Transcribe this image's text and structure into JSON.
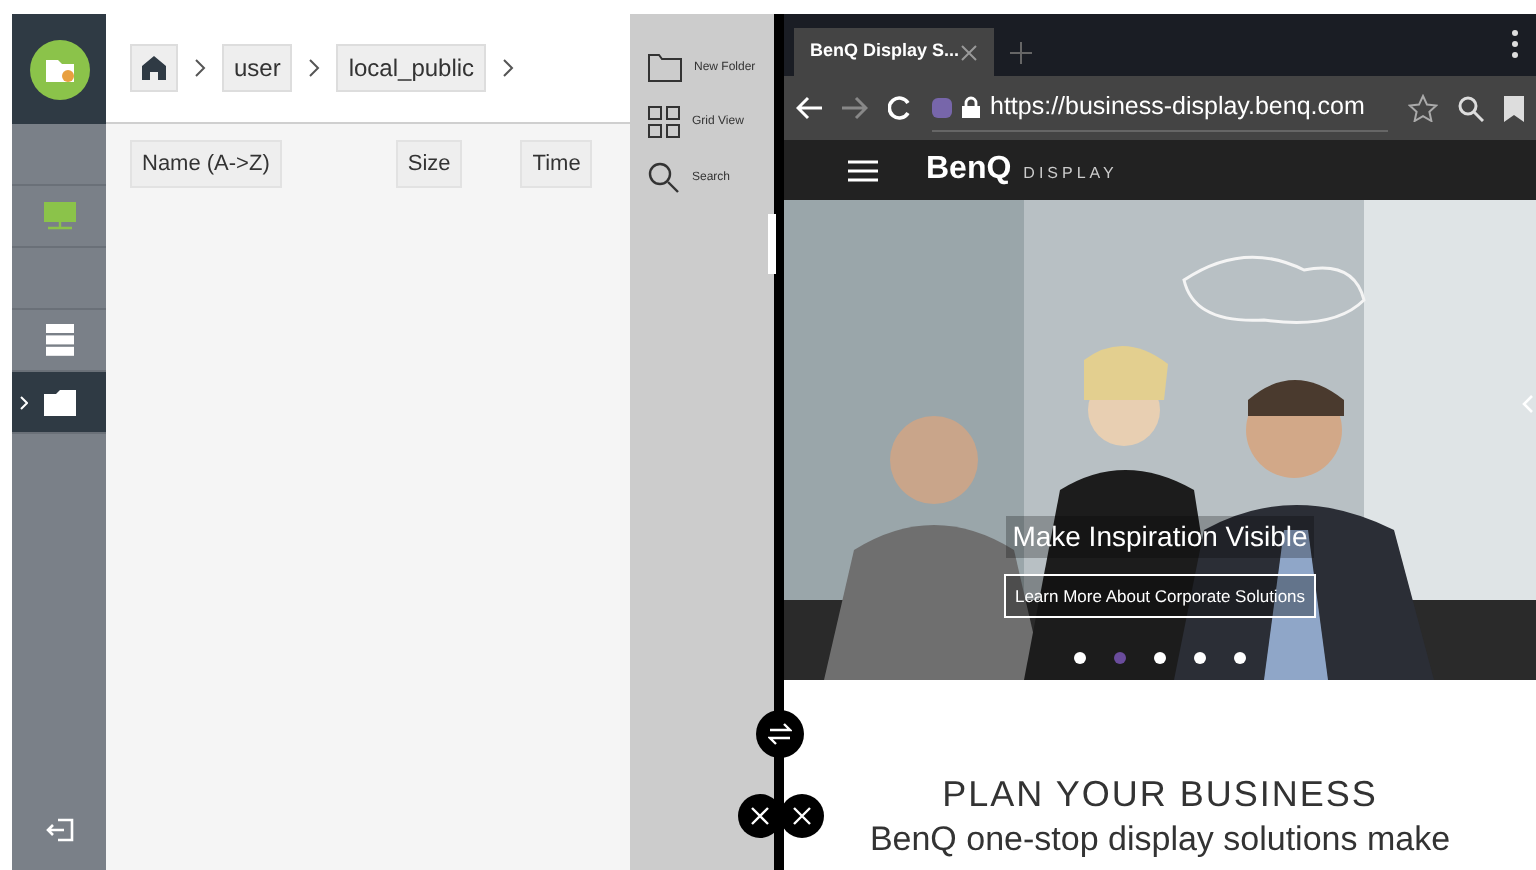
{
  "file_manager": {
    "breadcrumbs": [
      {
        "kind": "home"
      },
      {
        "kind": "crumb",
        "label": "user"
      },
      {
        "kind": "crumb",
        "label": "local_public"
      }
    ],
    "sidebar": [
      {
        "kind": "blank",
        "selected": false
      },
      {
        "kind": "network",
        "selected": false
      },
      {
        "kind": "blank",
        "selected": false
      },
      {
        "kind": "server",
        "selected": false
      },
      {
        "kind": "folder",
        "selected": true
      }
    ],
    "sort_buttons": [
      "Name (A->Z)",
      "Size",
      "Time"
    ],
    "tools": [
      {
        "kind": "new_folder",
        "label": "New Folder"
      },
      {
        "kind": "grid",
        "label": "Grid View"
      },
      {
        "kind": "search",
        "label": "Search"
      }
    ]
  },
  "browser": {
    "tab_title": "BenQ Display S...",
    "url": "https://business-display.benq.com",
    "site_logo": "BenQ",
    "site_logo_sub": "DISPLAY",
    "hero": {
      "headline": "Make Inspiration Visible",
      "button": "Learn More About Corporate Solutions",
      "dots": [
        {
          "selected": false
        },
        {
          "selected": true
        },
        {
          "selected": false
        },
        {
          "selected": false
        },
        {
          "selected": false
        }
      ]
    },
    "heading": "PLAN YOUR BUSINESS",
    "text": "BenQ one-stop display solutions make"
  }
}
